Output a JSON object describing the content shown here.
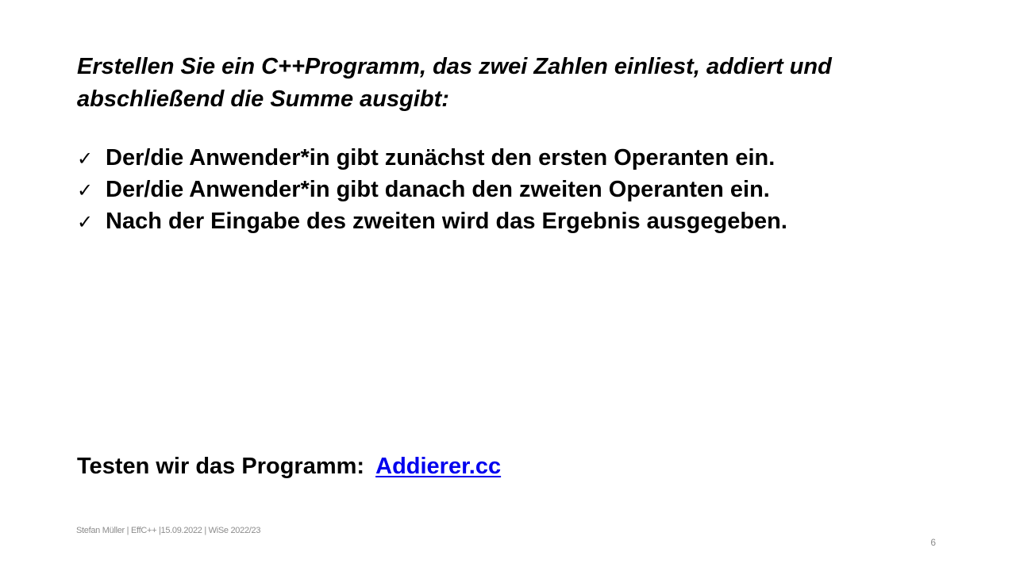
{
  "intro": {
    "line1": "Erstellen Sie ein C++Programm, das zwei Zahlen einliest, addiert und",
    "line2": "abschließend die Summe ausgibt:"
  },
  "checklist": {
    "check_symbol": "✓",
    "items": [
      "Der/die Anwender*in gibt zunächst den ersten Operanten ein.",
      "Der/die Anwender*in gibt danach den zweiten Operanten ein.",
      "Nach der Eingabe des zweiten wird das Ergebnis ausgegeben."
    ]
  },
  "test": {
    "label": "Testen wir das Programm:",
    "link_text": "Addierer.cc",
    "link_color": "#0000ee"
  },
  "footer": {
    "text": "Stefan Müller | EffC++ |15.09.2022 | WiSe 2022/23",
    "page_number": "6"
  }
}
